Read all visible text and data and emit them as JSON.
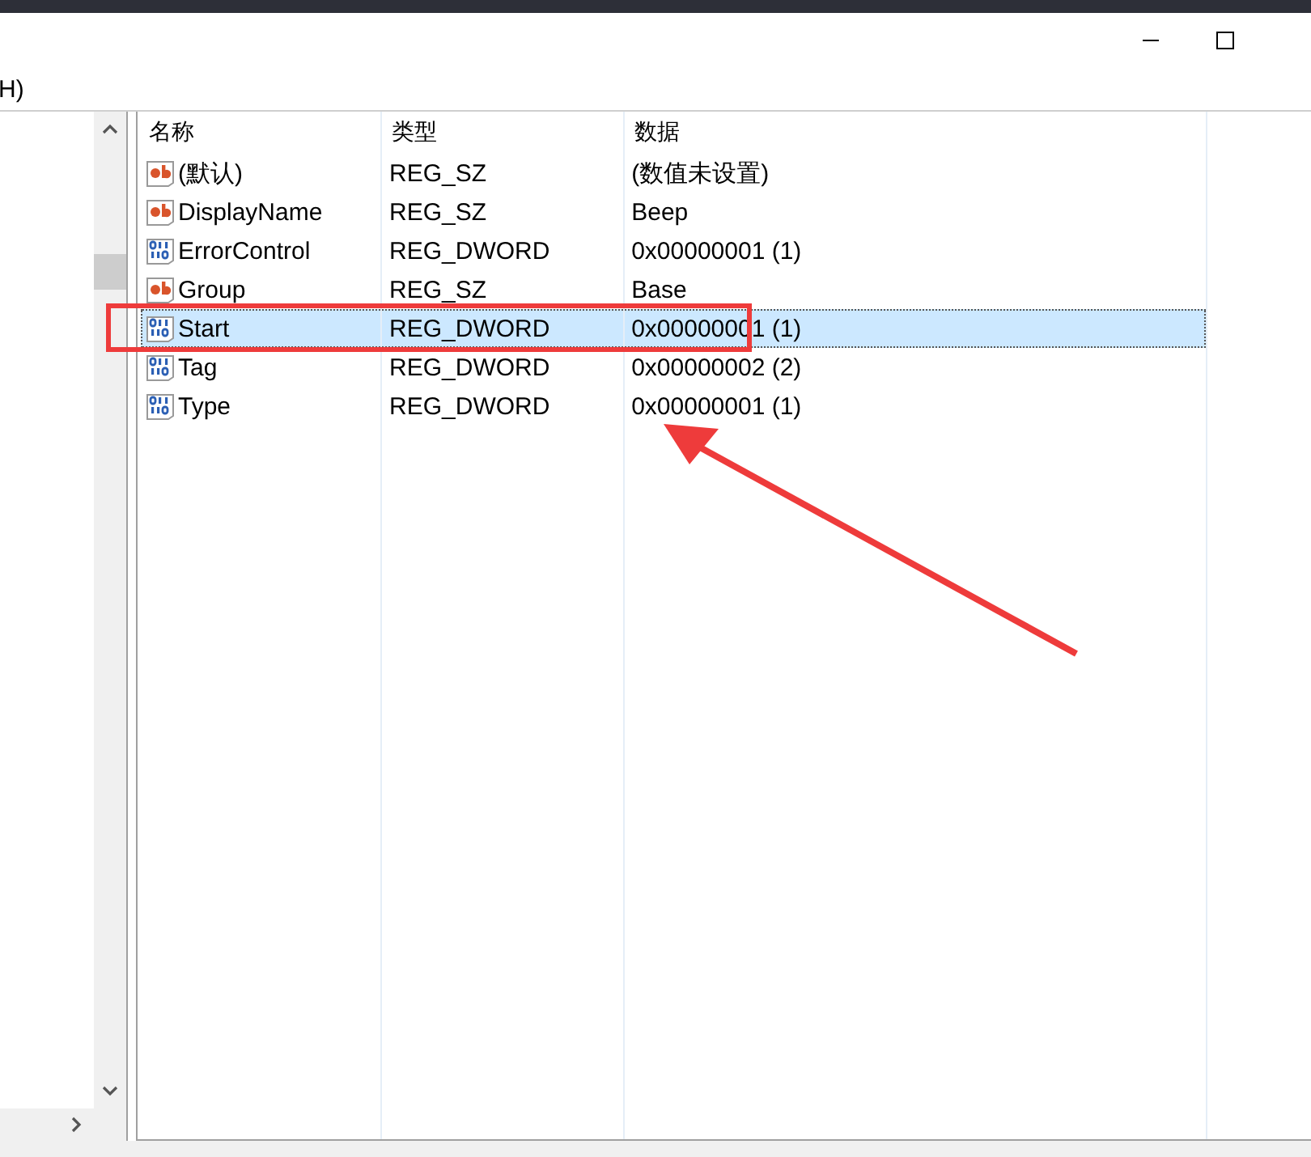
{
  "window": {
    "menu_fragment": "H)"
  },
  "list": {
    "columns": [
      "名称",
      "类型",
      "数据"
    ],
    "rows": [
      {
        "kind": "string",
        "name": "(默认)",
        "type": "REG_SZ",
        "data": "(数值未设置)",
        "selected": false
      },
      {
        "kind": "string",
        "name": "DisplayName",
        "type": "REG_SZ",
        "data": "Beep",
        "selected": false
      },
      {
        "kind": "dword",
        "name": "ErrorControl",
        "type": "REG_DWORD",
        "data": "0x00000001 (1)",
        "selected": false
      },
      {
        "kind": "string",
        "name": "Group",
        "type": "REG_SZ",
        "data": "Base",
        "selected": false
      },
      {
        "kind": "dword",
        "name": "Start",
        "type": "REG_DWORD",
        "data": "0x00000001 (1)",
        "selected": true
      },
      {
        "kind": "dword",
        "name": "Tag",
        "type": "REG_DWORD",
        "data": "0x00000002 (2)",
        "selected": false
      },
      {
        "kind": "dword",
        "name": "Type",
        "type": "REG_DWORD",
        "data": "0x00000001 (1)",
        "selected": false
      }
    ]
  }
}
